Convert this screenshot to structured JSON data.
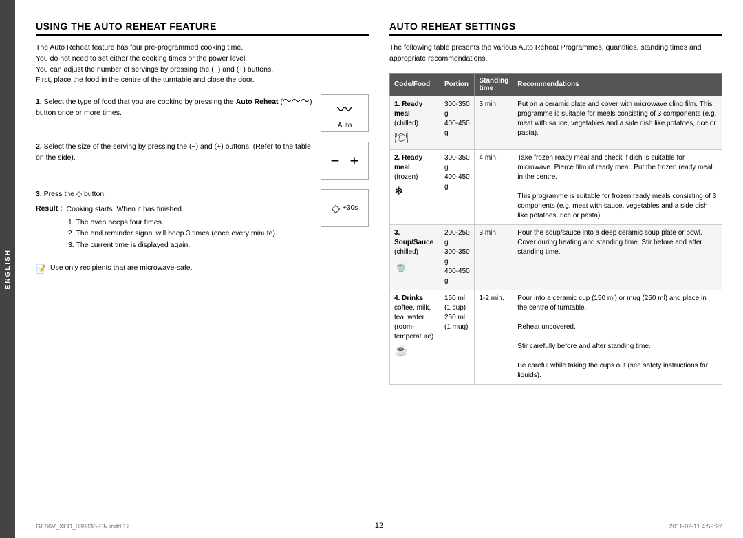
{
  "left_section": {
    "heading": "USING THE AUTO REHEAT FEATURE",
    "intro": [
      "The Auto Reheat feature has four pre-programmed cooking time.",
      "You do not need to set either the cooking times or the power level.",
      "You can adjust the number of servings by pressing the (−) and (+) buttons.",
      "First, place the food in the centre of the turntable and close the door."
    ],
    "steps": [
      {
        "number": "1.",
        "text_before": "Select the type of food that you are cooking by pressing the ",
        "bold": "Auto Reheat",
        "text_after": " (   ) button once or more times.",
        "box_type": "auto"
      },
      {
        "number": "2.",
        "text": "Select the size of the serving by pressing the (−) and (+) buttons. (Refer to the table on the side).",
        "box_type": "plusminus"
      },
      {
        "number": "3.",
        "text": "Press the   button.",
        "box_type": "start"
      }
    ],
    "result_label": "Result :",
    "result_lines": [
      "Cooking starts. When it has finished.",
      "1)  The oven beeps four times.",
      "2)  The end reminder signal will beep 3 times (once every minute).",
      "3)  The current time is displayed again."
    ],
    "note": "Use only recipients that are microwave-safe."
  },
  "right_section": {
    "heading": "AUTO REHEAT SETTINGS",
    "intro": "The following table presents the various Auto Reheat Programmes, quantities, standing times and appropriate recommendations.",
    "table": {
      "headers": [
        "Code/Food",
        "Portion",
        "Standing time",
        "Recommendations"
      ],
      "rows": [
        {
          "code": "1. Ready meal",
          "sub": "(chilled)",
          "icon": "🍽",
          "portion": "300-350 g\n400-450 g",
          "standing": "3 min.",
          "recommendations": "Put on a ceramic plate and cover with microwave cling film. This programme is suitable for meals consisting of 3 components (e.g. meat with sauce, vegetables and a side dish like potatoes, rice or pasta)."
        },
        {
          "code": "2. Ready meal",
          "sub": "(frozen)",
          "icon": "❄",
          "portion": "300-350 g\n400-450 g",
          "standing": "4 min.",
          "recommendations": "Take frozen ready meal and check if dish is suitable for microwave. Pierce film of ready meal. Put the frozen ready meal in the centre.\nThis programme is suitable for frozen ready meals consisting of 3 components (e.g. meat with sauce, vegetables and a side dish like potatoes, rice or pasta)."
        },
        {
          "code": "3. Soup/Sauce",
          "sub": "(chilled)",
          "icon": "🍜",
          "portion": "200-250 g\n300-350 g\n400-450 g",
          "standing": "3 min.",
          "recommendations": "Pour the soup/sauce into a deep ceramic soup plate or bowl. Cover during heating and standing time. Stir before and after standing time."
        },
        {
          "code": "4. Drinks",
          "sub": "coffee, milk, tea, water (room-temperature)",
          "icon": "☕",
          "portion": "150 ml\n(1 cup)\n250 ml\n(1 mug)",
          "standing": "1-2 min.",
          "recommendations": "Pour into a ceramic cup (150 ml) or mug (250 ml) and place in the centre of turntable.\nReheat uncovered.\nStir carefully before and after standing time.\nBe careful while taking the cups out (see safety instructions for liquids)."
        }
      ]
    }
  },
  "sidebar_label": "ENGLISH",
  "page_number": "12",
  "file_name": "GE86V_XEO_03933B-EN.indd  12",
  "date": "2011-02-11   4:59:22"
}
